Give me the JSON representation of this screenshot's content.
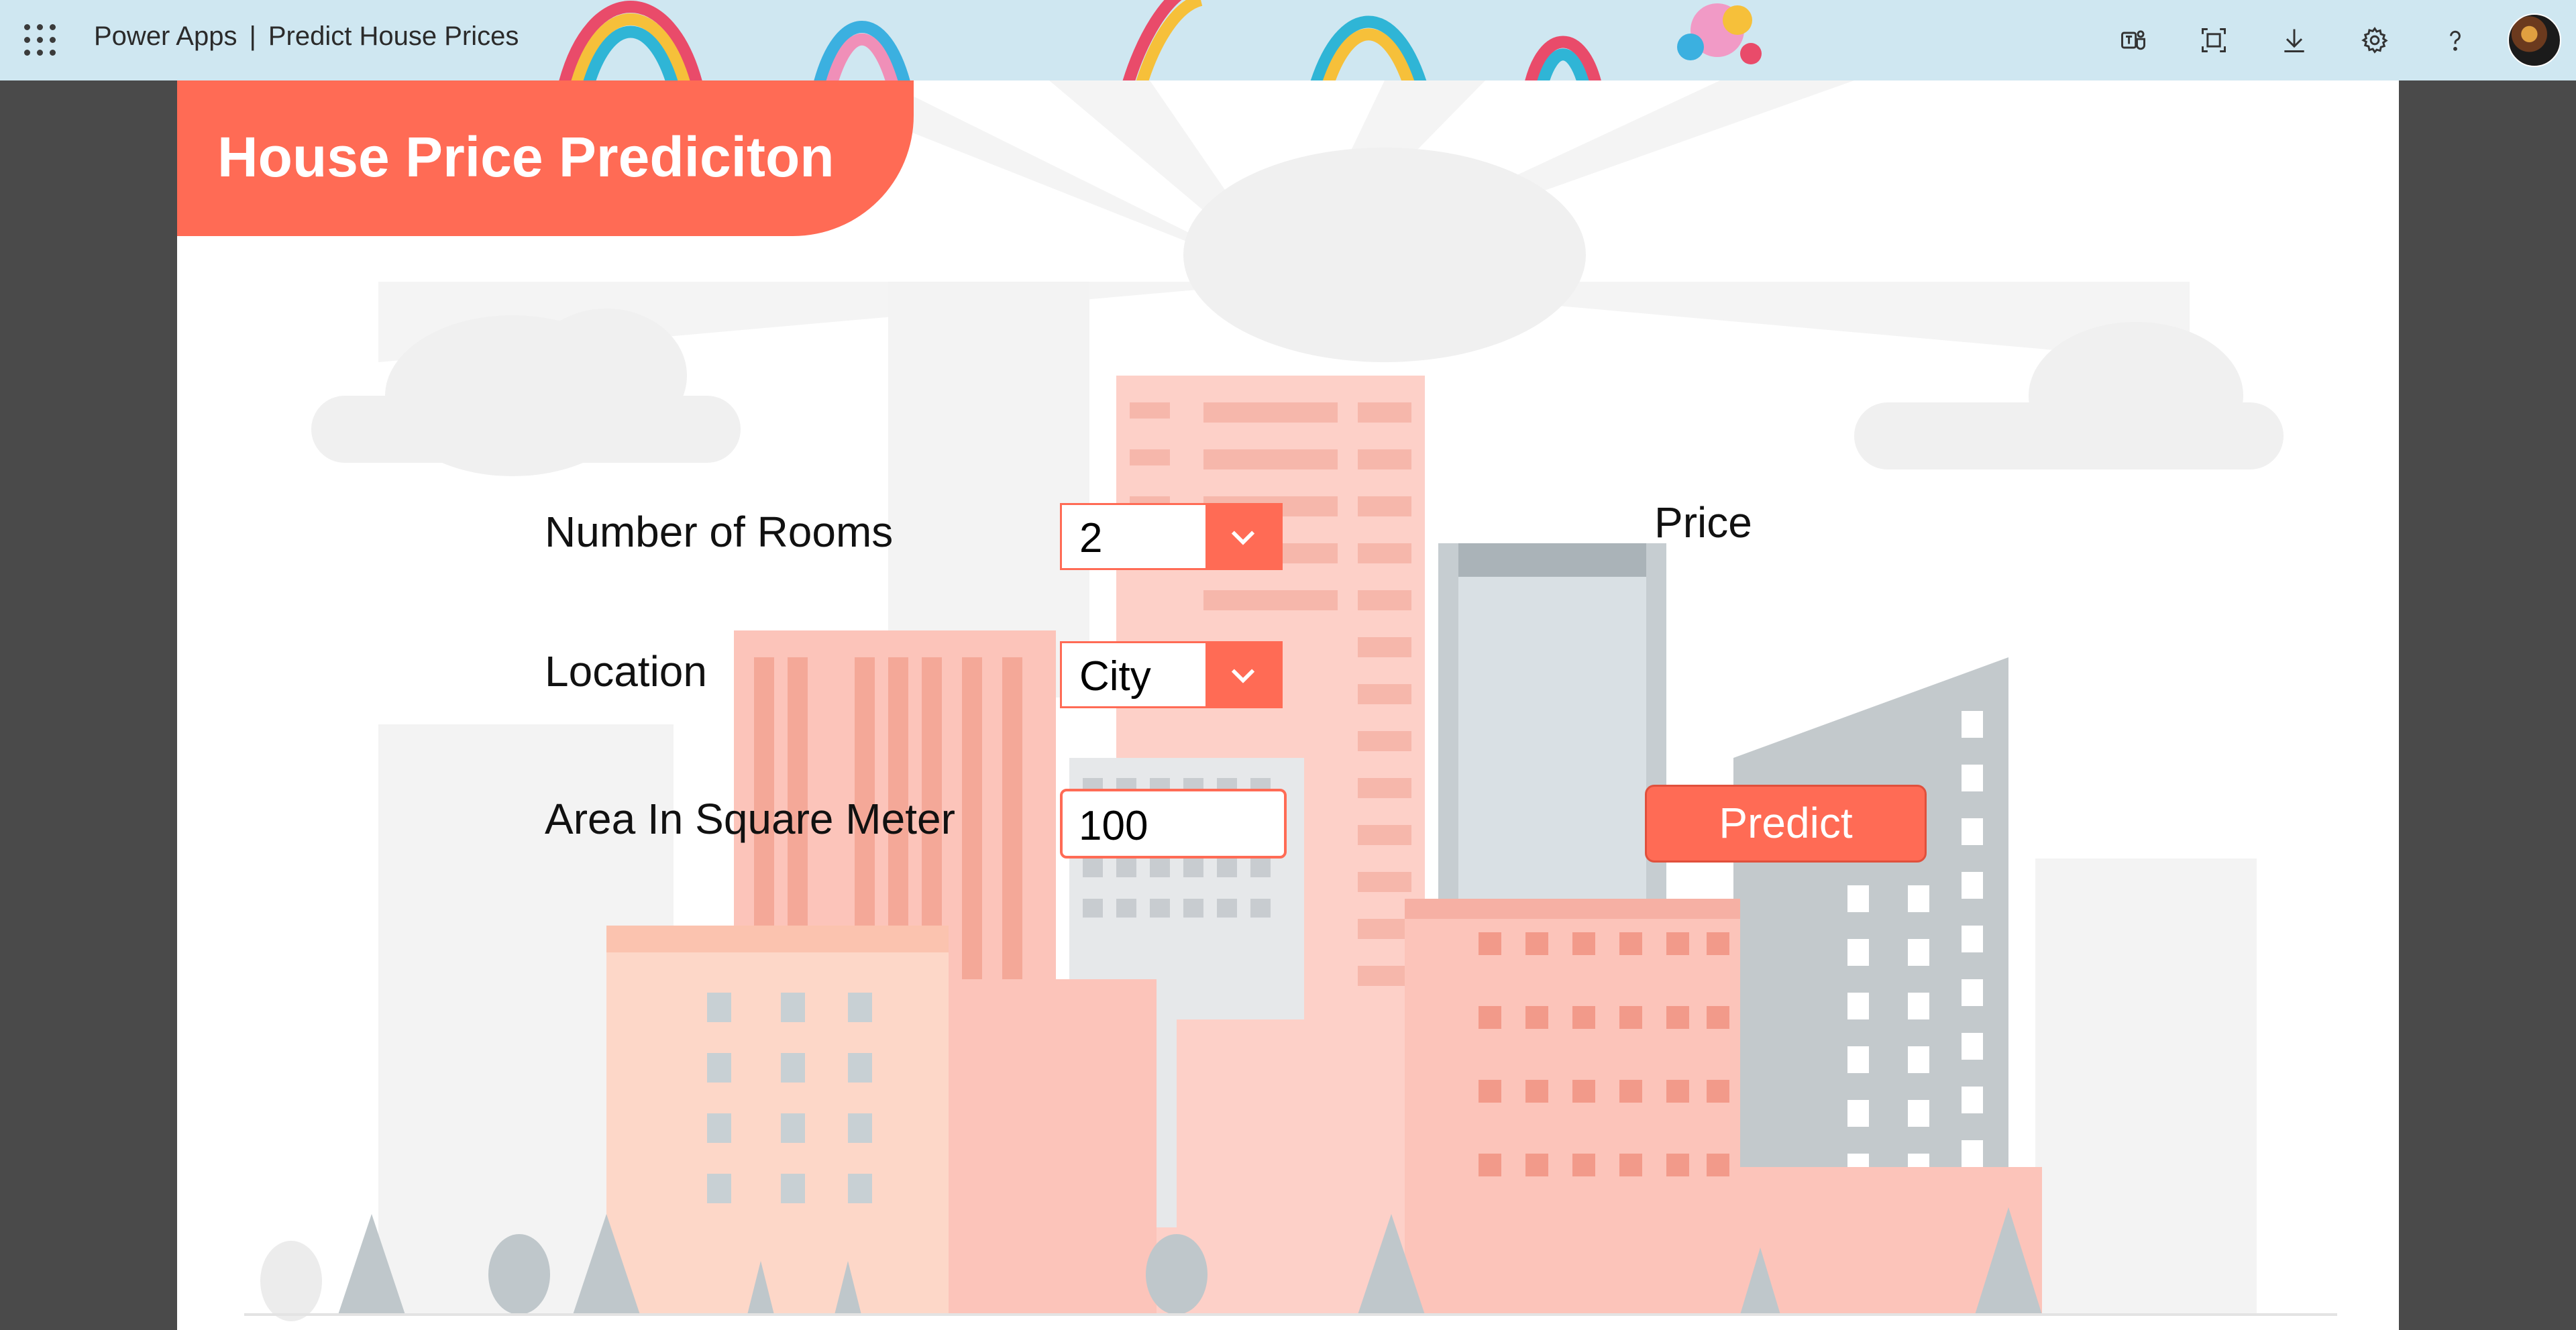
{
  "header": {
    "app_name": "Power Apps",
    "separator": "|",
    "app_title": "Predict House Prices",
    "icons": [
      "waffle-icon",
      "teams-icon",
      "fit-to-window-icon",
      "download-icon",
      "settings-icon",
      "help-icon",
      "user-avatar"
    ]
  },
  "app": {
    "title": "House Price Prediciton",
    "rooms": {
      "label": "Number of Rooms",
      "value": "2"
    },
    "location": {
      "label": "Location",
      "value": "City"
    },
    "area": {
      "label": "Area In Square Meter",
      "value": "100"
    },
    "price_label": "Price",
    "predict_label": "Predict"
  },
  "colors": {
    "accent": "#ff6b55",
    "header_bg": "#cfe7f1",
    "outer_bg": "#4a4a4a"
  }
}
